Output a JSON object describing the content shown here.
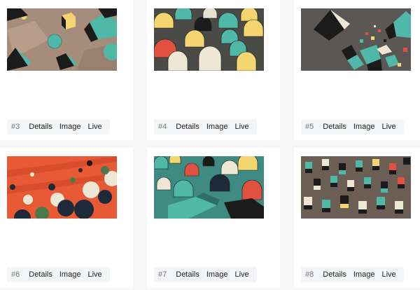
{
  "cards": [
    {
      "number": "#3",
      "details": "Details",
      "image": "Image",
      "live": "Live",
      "palette": "beige-teal"
    },
    {
      "number": "#4",
      "details": "Details",
      "image": "Image",
      "live": "Live",
      "palette": "arches"
    },
    {
      "number": "#5",
      "details": "Details",
      "image": "Image",
      "live": "Live",
      "palette": "dark-cubes"
    },
    {
      "number": "#6",
      "details": "Details",
      "image": "Image",
      "live": "Live",
      "palette": "orange-spheres"
    },
    {
      "number": "#7",
      "details": "Details",
      "image": "Image",
      "live": "Live",
      "palette": "teal-arches"
    },
    {
      "number": "#8",
      "details": "Details",
      "image": "Image",
      "live": "Live",
      "palette": "cube-field"
    }
  ],
  "colors": {
    "page": "#f6f6f7",
    "card": "#ffffff",
    "pill": "#f4f5f7",
    "teal": "#4fb8a6",
    "yellow": "#f5d56f",
    "red": "#e0523f",
    "cream": "#efe7d6",
    "dark": "#1b1b1b",
    "orange": "#e85a35",
    "navy": "#1e2a3a"
  }
}
